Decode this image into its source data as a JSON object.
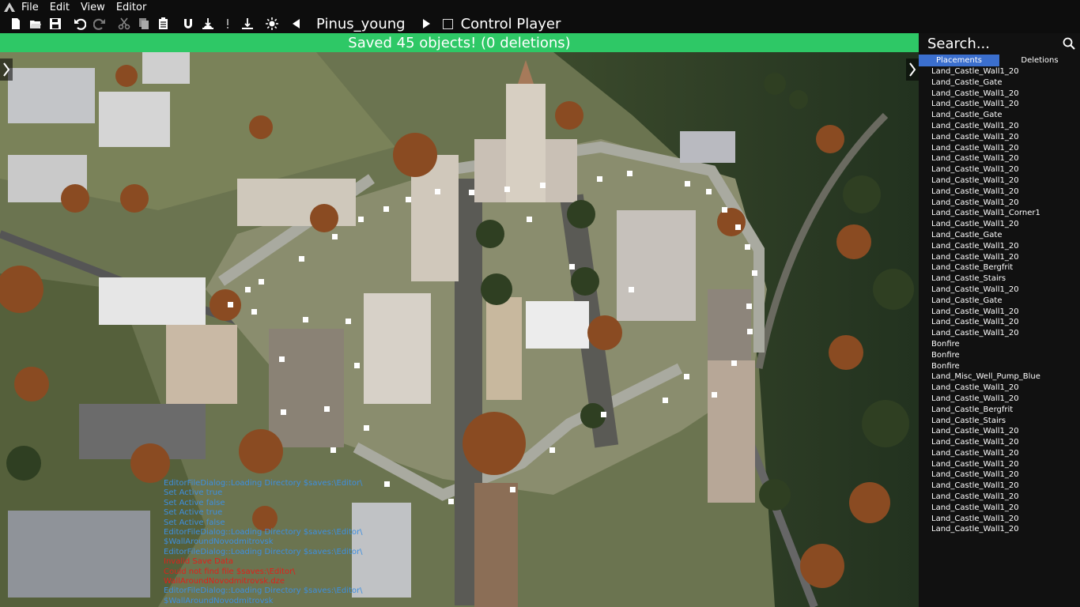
{
  "menu": {
    "items": [
      "File",
      "Edit",
      "View",
      "Editor"
    ]
  },
  "toolbar": {
    "object_name": "Pinus_young",
    "control_player_label": "Control Player",
    "icons": [
      "new-file-icon",
      "open-folder-icon",
      "save-icon",
      "undo-icon",
      "redo-icon",
      "cut-icon",
      "copy-icon",
      "paste-icon",
      "magnet-icon",
      "ground-snap-icon",
      "exclamation-icon",
      "place-on-ground-icon",
      "sun-icon",
      "previous-icon",
      "next-icon"
    ]
  },
  "status": {
    "message": "Saved 45 objects! (0 deletions)",
    "color": "#2ec866"
  },
  "panel": {
    "search_placeholder": "Search...",
    "tabs": [
      "Placements",
      "Deletions"
    ],
    "active_tab": "Placements",
    "items": [
      "Land_Castle_Wall1_20",
      "Land_Castle_Gate",
      "Land_Castle_Wall1_20",
      "Land_Castle_Wall1_20",
      "Land_Castle_Gate",
      "Land_Castle_Wall1_20",
      "Land_Castle_Wall1_20",
      "Land_Castle_Wall1_20",
      "Land_Castle_Wall1_20",
      "Land_Castle_Wall1_20",
      "Land_Castle_Wall1_20",
      "Land_Castle_Wall1_20",
      "Land_Castle_Wall1_20",
      "Land_Castle_Wall1_Corner1",
      "Land_Castle_Wall1_20",
      "Land_Castle_Gate",
      "Land_Castle_Wall1_20",
      "Land_Castle_Wall1_20",
      "Land_Castle_Bergfrit",
      "Land_Castle_Stairs",
      "Land_Castle_Wall1_20",
      "Land_Castle_Gate",
      "Land_Castle_Wall1_20",
      "Land_Castle_Wall1_20",
      "Land_Castle_Wall1_20",
      "Bonfire",
      "Bonfire",
      "Bonfire",
      "Land_Misc_Well_Pump_Blue",
      "Land_Castle_Wall1_20",
      "Land_Castle_Wall1_20",
      "Land_Castle_Bergfrit",
      "Land_Castle_Stairs",
      "Land_Castle_Wall1_20",
      "Land_Castle_Wall1_20",
      "Land_Castle_Wall1_20",
      "Land_Castle_Wall1_20",
      "Land_Castle_Wall1_20",
      "Land_Castle_Wall1_20",
      "Land_Castle_Wall1_20",
      "Land_Castle_Wall1_20",
      "Land_Castle_Wall1_20",
      "Land_Castle_Wall1_20"
    ]
  },
  "log": [
    {
      "text": "EditorFileDialog::Loading Directory $saves:\\Editor\\",
      "level": "info"
    },
    {
      "text": "Set Active true",
      "level": "info"
    },
    {
      "text": "Set Active false",
      "level": "info"
    },
    {
      "text": "Set Active true",
      "level": "info"
    },
    {
      "text": "Set Active false",
      "level": "info"
    },
    {
      "text": "EditorFileDialog::Loading Directory $saves:\\Editor\\",
      "level": "info"
    },
    {
      "text": "$WallAroundNovodmitrovsk",
      "level": "info"
    },
    {
      "text": "EditorFileDialog::Loading Directory $saves:\\Editor\\",
      "level": "info"
    },
    {
      "text": "Invalid Save Data",
      "level": "err"
    },
    {
      "text": "Could not find file $saves:\\Editor\\",
      "level": "err"
    },
    {
      "text": "WallAroundNovodmitrovsk.dze",
      "level": "err"
    },
    {
      "text": "EditorFileDialog::Loading Directory $saves:\\Editor\\",
      "level": "info"
    },
    {
      "text": "$WallAroundNovodmitrovsk",
      "level": "info"
    }
  ]
}
